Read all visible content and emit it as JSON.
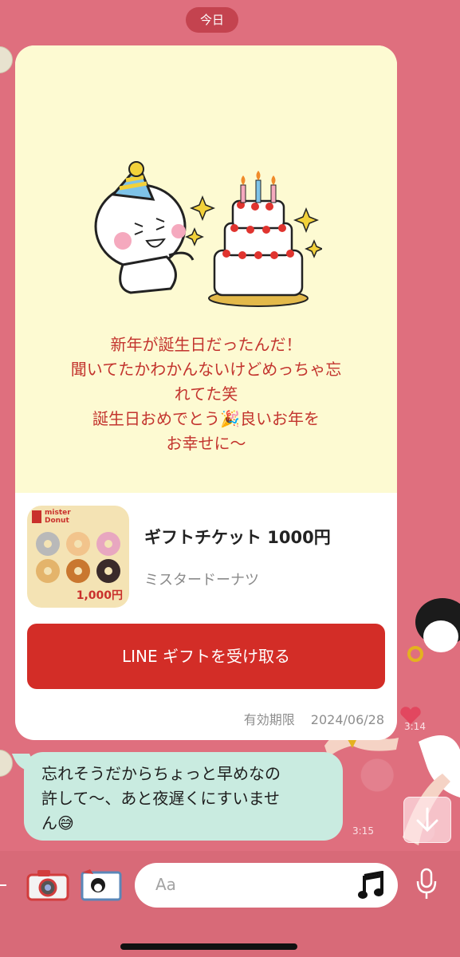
{
  "chat": {
    "date_label": "今日"
  },
  "gift_card": {
    "message_lines": [
      "新年が誕生日だったんだ！",
      "聞いてたかわかんないけどめっちゃ忘",
      "れてた笑",
      "誕生日おめでとう🎉良いお年を",
      "お幸せに〜"
    ],
    "gift_title": "ギフトチケット 1000円",
    "gift_brand": "ミスタードーナツ",
    "thumb_brand_line1": "mister",
    "thumb_brand_line2": "Donut",
    "thumb_price": "1,000円",
    "receive_button": "LINE ギフトを受け取る",
    "expiry_label": "有効期限",
    "expiry_date": "2024/06/28"
  },
  "messages": [
    {
      "time": "3:14"
    },
    {
      "lines": [
        "忘れそうだからちょっと早めなの",
        "許して〜、あと夜遅くにすいませ",
        "ん😅"
      ],
      "time": "3:15"
    }
  ],
  "composer": {
    "placeholder": "Aa",
    "icons": [
      "more-icon",
      "camera-icon",
      "photo-icon",
      "music-icon",
      "microphone-icon"
    ]
  },
  "colors": {
    "chat_bg": "#df6f7e",
    "card_bg": "#fdfad2",
    "accent_red": "#d32d27",
    "bubble_bg": "#c9ebe0"
  }
}
